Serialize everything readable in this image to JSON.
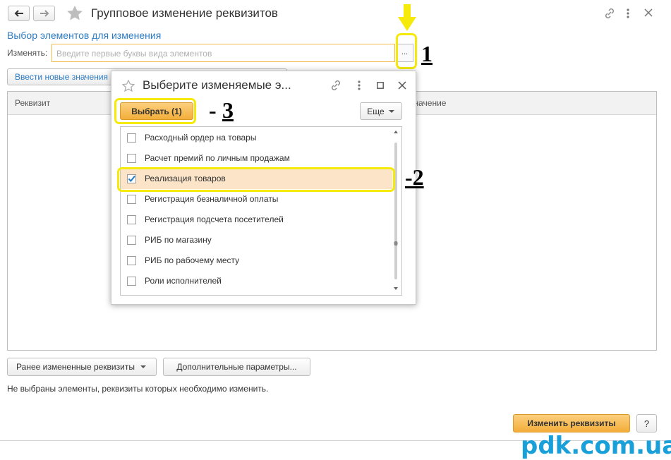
{
  "window": {
    "title": "Групповое изменение реквизитов",
    "section_title": "Выбор элементов для изменения",
    "change_label": "Изменять:",
    "change_placeholder": "Введите первые буквы вида элементов",
    "select_button": "..."
  },
  "toolbar": {
    "enter_values_button": "Ввести новые значения"
  },
  "table": {
    "columns": [
      "Реквизит",
      "значение"
    ]
  },
  "dialog": {
    "title": "Выберите изменяемые э...",
    "choose_button": "Выбрать (1)",
    "more_button": "Еще",
    "items": [
      {
        "label": "Расходный ордер на товары",
        "checked": false
      },
      {
        "label": "Расчет премий по личным продажам",
        "checked": false
      },
      {
        "label": "Реализация товаров",
        "checked": true
      },
      {
        "label": "Регистрация безналичной оплаты",
        "checked": false
      },
      {
        "label": "Регистрация подсчета посетителей",
        "checked": false
      },
      {
        "label": "РИБ по магазину",
        "checked": false
      },
      {
        "label": "РИБ по рабочему месту",
        "checked": false
      },
      {
        "label": "Роли исполнителей",
        "checked": false
      }
    ]
  },
  "bottom": {
    "prev_changed_button": "Ранее измененные реквизиты",
    "extra_params_button": "Дополнительные параметры...",
    "status_text": "Не выбраны элементы, реквизиты которых необходимо изменить.",
    "apply_button": "Изменить реквизиты",
    "help_button": "?"
  },
  "annotations": {
    "mark1": "1",
    "mark2": "-2",
    "mark3_dash": "-",
    "mark3": "3"
  },
  "watermark": "pdk.com.ua",
  "colors": {
    "accent_link": "#2e7cc2",
    "primary_button": "#f5b949",
    "highlight": "#f5ea0a",
    "selected_row": "#fbe4c8",
    "watermark": "#1aa0d8"
  }
}
